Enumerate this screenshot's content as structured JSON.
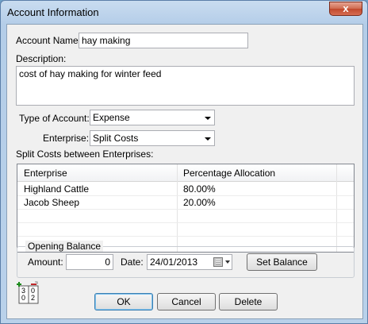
{
  "window": {
    "title": "Account Information",
    "close_glyph": "x"
  },
  "form": {
    "account_name_label": "Account Name:",
    "account_name_value": "hay making",
    "description_label": "Description:",
    "description_value": "cost of hay making for winter feed",
    "type_label": "Type of Account:",
    "type_value": "Expense",
    "enterprise_label": "Enterprise:",
    "enterprise_value": "Split Costs",
    "split_label": "Split Costs between Enterprises:"
  },
  "grid": {
    "columns": [
      "Enterprise",
      "Percentage Allocation"
    ],
    "rows": [
      [
        "Highland Cattle",
        "80.00%"
      ],
      [
        "Jacob Sheep",
        "20.00%"
      ],
      [
        "",
        ""
      ],
      [
        "",
        ""
      ]
    ]
  },
  "opening_balance": {
    "group_label": "Opening Balance",
    "amount_label": "Amount:",
    "amount_value": "0",
    "date_label": "Date:",
    "date_value": "24/01/2013",
    "set_balance_label": "Set Balance"
  },
  "buttons": {
    "ok_label": "OK",
    "cancel_label": "Cancel",
    "delete_label": "Delete"
  },
  "icon": {
    "name": "account-numbers-icon",
    "digits_left": [
      "3",
      "0"
    ],
    "digits_right": [
      "0",
      "2"
    ]
  }
}
